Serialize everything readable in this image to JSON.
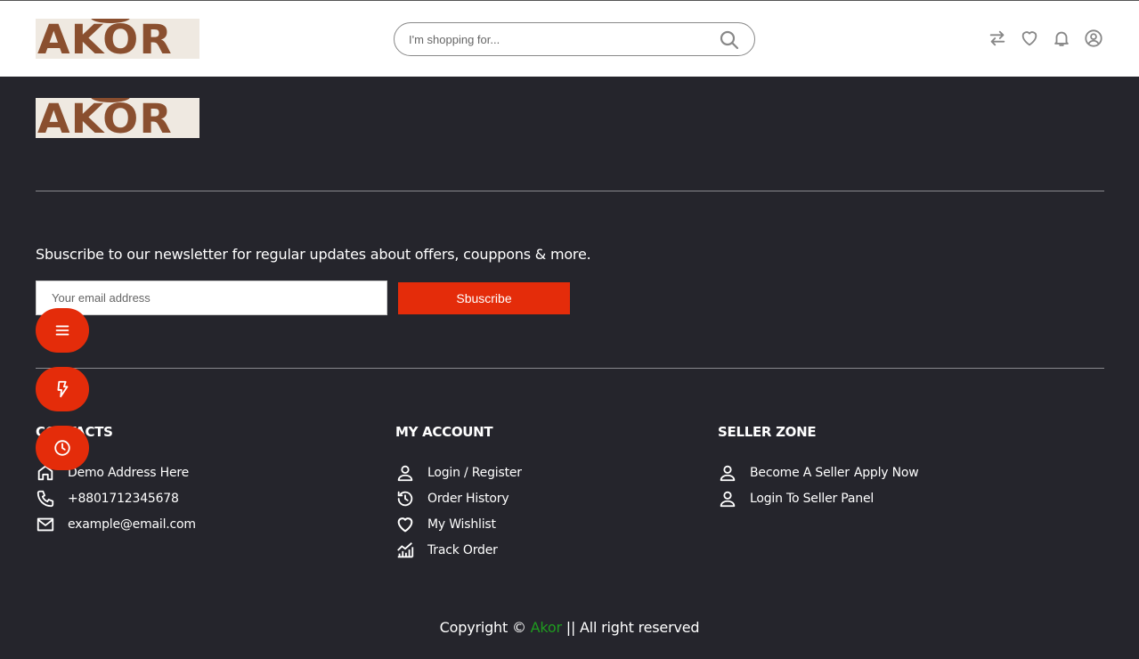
{
  "header": {
    "logo_text": "AKOR",
    "search_placeholder": "I'm shopping for...",
    "icons": [
      "compare-icon",
      "heart-icon",
      "bell-icon",
      "user-circle-icon"
    ]
  },
  "footer": {
    "logo_text": "AKOR",
    "newsletter": {
      "text": "Sbuscribe to our newsletter for regular updates about offers, couppons & more.",
      "email_placeholder": "Your email address",
      "button_label": "Sbuscribe"
    },
    "contacts": {
      "heading": "CONTACTS",
      "address": "Demo Address Here",
      "phone": "+8801712345678",
      "email": "example@email.com"
    },
    "account": {
      "heading": "MY ACCOUNT",
      "login": "Login / Register",
      "order_history": "Order History",
      "wishlist": "My Wishlist",
      "track_order": "Track Order"
    },
    "seller": {
      "heading": "SELLER ZONE",
      "become_seller": "Become A Seller",
      "apply_now": "Apply Now",
      "seller_panel": "Login To Seller Panel"
    },
    "copyright": {
      "prefix": "Copyright ©",
      "brand": "Akor",
      "suffix": "|| All right reserved"
    }
  },
  "colors": {
    "accent": "#e42c0a",
    "footer_bg": "#25252c",
    "link_green": "#1f9b1f",
    "logo_brown": "#8a4f2f"
  }
}
